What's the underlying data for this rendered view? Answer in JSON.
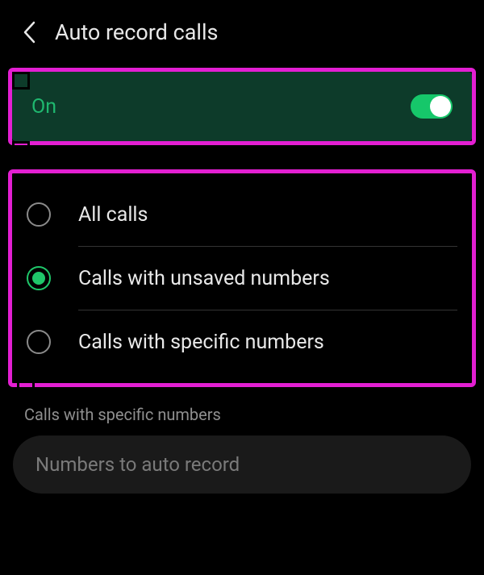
{
  "header": {
    "title": "Auto record calls"
  },
  "toggle": {
    "label": "On",
    "state": true
  },
  "options": [
    {
      "label": "All calls",
      "selected": false
    },
    {
      "label": "Calls with unsaved numbers",
      "selected": true
    },
    {
      "label": "Calls with specific numbers",
      "selected": false
    }
  ],
  "specific": {
    "section_label": "Calls with specific numbers",
    "placeholder": "Numbers to auto record"
  }
}
